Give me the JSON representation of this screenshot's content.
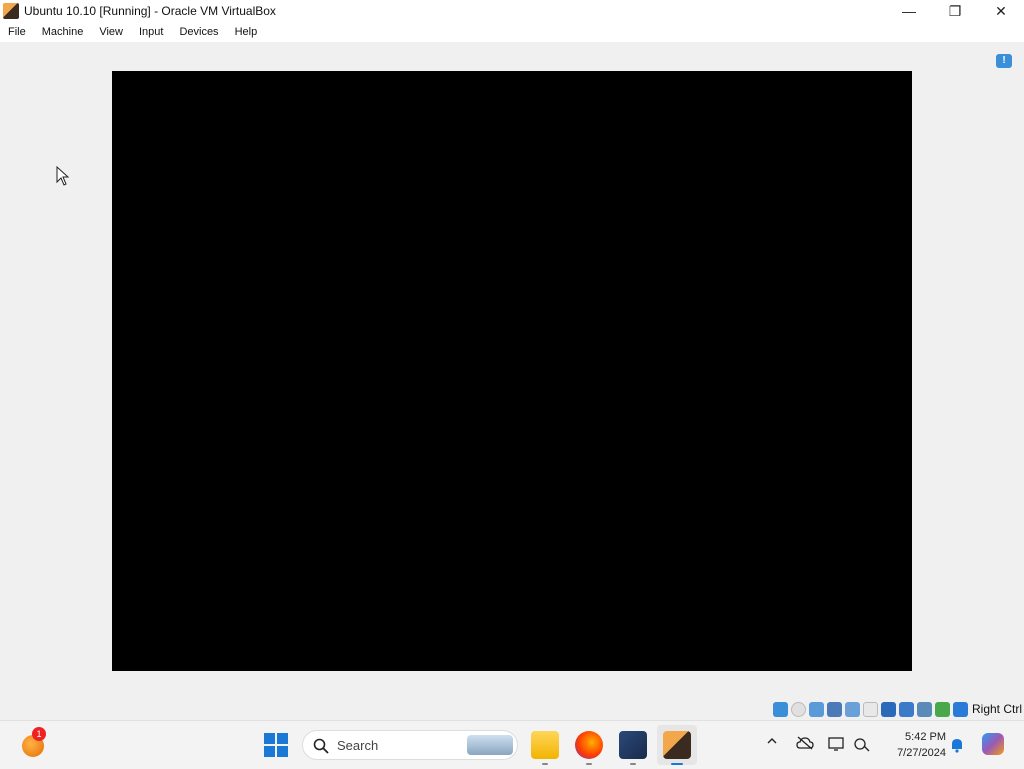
{
  "window": {
    "title": "Ubuntu 10.10 [Running] - Oracle VM VirtualBox",
    "controls": {
      "minimize": "—",
      "maximize": "❐",
      "close": "✕"
    }
  },
  "menu": {
    "items": [
      "File",
      "Machine",
      "View",
      "Input",
      "Devices",
      "Help"
    ]
  },
  "statusbar": {
    "host_key": "Right Ctrl"
  },
  "taskbar": {
    "weather_badge": "1",
    "search_label": "Search",
    "clock_time": "5:42 PM",
    "clock_date": "7/27/2024"
  },
  "colors": {
    "vm_screen": "#000000",
    "accent": "#1a78d6",
    "window_bg": "#f0f0f0"
  }
}
